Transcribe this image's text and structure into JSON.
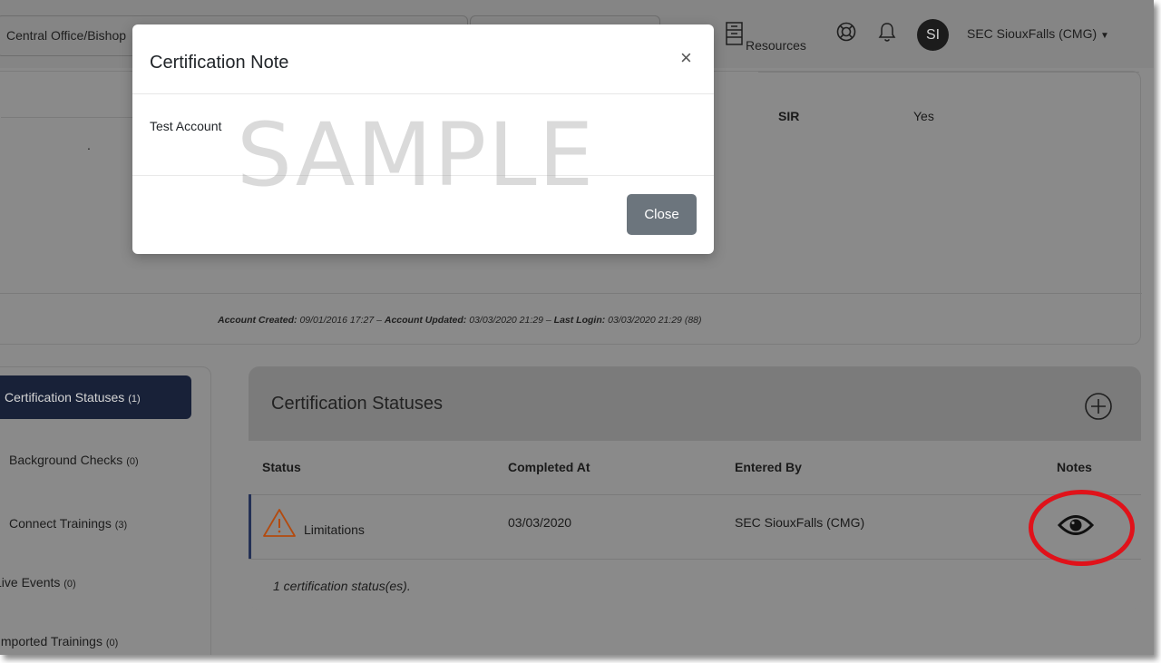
{
  "header": {
    "office_select": "Central Office/Bishop",
    "resources": "Resources",
    "avatar_initials": "SI",
    "user_name": "SEC SiouxFalls (CMG)"
  },
  "profile": {
    "sir_label": "SIR",
    "sir_value": "Yes",
    "dot": ".",
    "account_created_label": "Account Created:",
    "account_created": "09/01/2016 17:27",
    "account_updated_label": "Account Updated:",
    "account_updated": "03/03/2020 21:29",
    "last_login_label": "Last Login:",
    "last_login": "03/03/2020 21:29 (88)",
    "separator": " – "
  },
  "sidebar": {
    "items": [
      {
        "label": "Certification Statuses",
        "count": "(1)"
      },
      {
        "label": "Background Checks",
        "count": "(0)"
      },
      {
        "label": "Connect Trainings",
        "count": "(3)"
      },
      {
        "label": "Live Events",
        "count": "(0)"
      },
      {
        "label": "Imported Trainings",
        "count": "(0)"
      }
    ]
  },
  "statuses": {
    "title": "Certification Statuses",
    "columns": [
      "Status",
      "Completed At",
      "Entered By",
      "Notes"
    ],
    "rows": [
      {
        "status": "Limitations",
        "completed_at": "03/03/2020",
        "entered_by": "SEC SiouxFalls (CMG)"
      }
    ],
    "footer": "1 certification status(es)."
  },
  "modal": {
    "title": "Certification Note",
    "close_symbol": "×",
    "body": "Test Account",
    "close_button": "Close",
    "watermark": "SAMPLE"
  },
  "colors": {
    "active_nav": "#182138",
    "annotation_red": "#e0121a",
    "close_button": "#6c757d"
  },
  "icons": [
    "resources-icon",
    "help-icon",
    "bell-icon",
    "add-circle-icon",
    "warning-icon",
    "eye-icon",
    "close-icon"
  ]
}
